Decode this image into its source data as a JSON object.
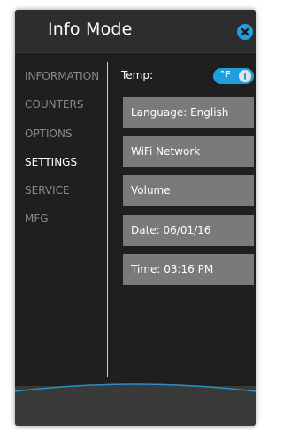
{
  "header": {
    "title": "Info Mode",
    "close_icon": "close-icon"
  },
  "sidebar": {
    "items": [
      {
        "label": "INFORMATION",
        "active": false
      },
      {
        "label": "COUNTERS",
        "active": false
      },
      {
        "label": "OPTIONS",
        "active": false
      },
      {
        "label": "SETTINGS",
        "active": true
      },
      {
        "label": "SERVICE",
        "active": false
      },
      {
        "label": "MFG",
        "active": false
      }
    ]
  },
  "settings": {
    "temp_label": "Temp:",
    "temp_unit": "°F",
    "buttons": [
      "Language: English",
      "WiFi Network",
      "Volume",
      "Date: 06/01/16",
      "Time: 03:16 PM"
    ]
  },
  "colors": {
    "accent": "#1f9fde",
    "panel_bg": "#1f1f1f",
    "button_bg": "#7a7a7a",
    "inactive_text": "#8a8a8a"
  }
}
